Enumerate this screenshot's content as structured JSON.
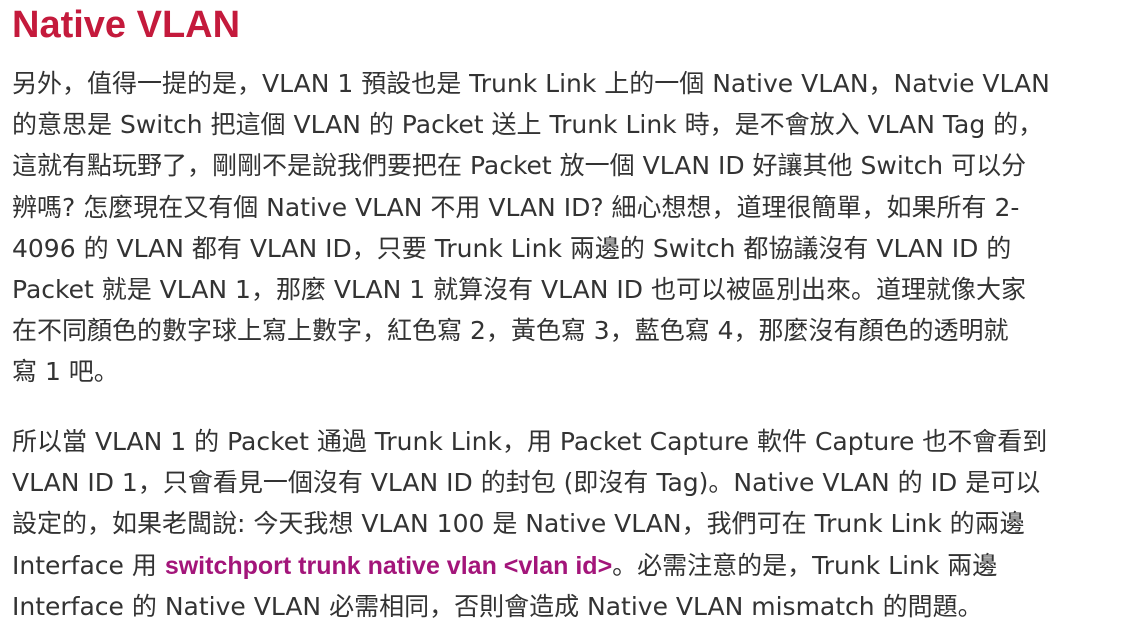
{
  "heading": {
    "text": "Native VLAN",
    "color": "#c41a3c"
  },
  "paragraph1": {
    "lines": [
      "另外，值得一提的是，VLAN 1 預設也是 Trunk Link 上的一個 Native VLAN，Natvie VLAN",
      "的意思是 Switch 把這個 VLAN 的 Packet 送上 Trunk Link 時，是不會放入 VLAN Tag 的，",
      "這就有點玩野了，剛剛不是說我們要把在 Packet 放一個 VLAN ID 好讓其他 Switch 可以分",
      "辨嗎? 怎麼現在又有個 Native VLAN 不用 VLAN ID? 細心想想，道理很簡單，如果所有 2-",
      "4096 的 VLAN 都有 VLAN ID，只要 Trunk Link 兩邊的 Switch 都協議沒有 VLAN ID 的",
      "Packet 就是 VLAN 1，那麼 VLAN 1 就算沒有 VLAN ID 也可以被區別出來。道理就像大家",
      "在不同顏色的數字球上寫上數字，紅色寫 2，黃色寫 3，藍色寫 4，那麼沒有顏色的透明就",
      "寫 1 吧。"
    ]
  },
  "paragraph2": {
    "line1": "所以當 VLAN 1 的 Packet 通過 Trunk Link，用 Packet Capture 軟件 Capture 也不會看到",
    "line2": "VLAN ID 1，只會看見一個沒有 VLAN ID 的封包 (即沒有 Tag)。Native VLAN 的 ID 是可以",
    "line3": "設定的，如果老闆說: 今天我想 VLAN 100 是 Native VLAN，我們可在 Trunk Link 的兩邊",
    "line4_prefix": "Interface 用 ",
    "line4_command": "switchport trunk native vlan <vlan id>",
    "line4_suffix": "。必需注意的是，Trunk Link 兩邊",
    "line5": "Interface 的 Native VLAN 必需相同，否則會造成 Native VLAN mismatch 的問題。",
    "command_color": "#a3157a"
  },
  "body_text_color": "#333333"
}
